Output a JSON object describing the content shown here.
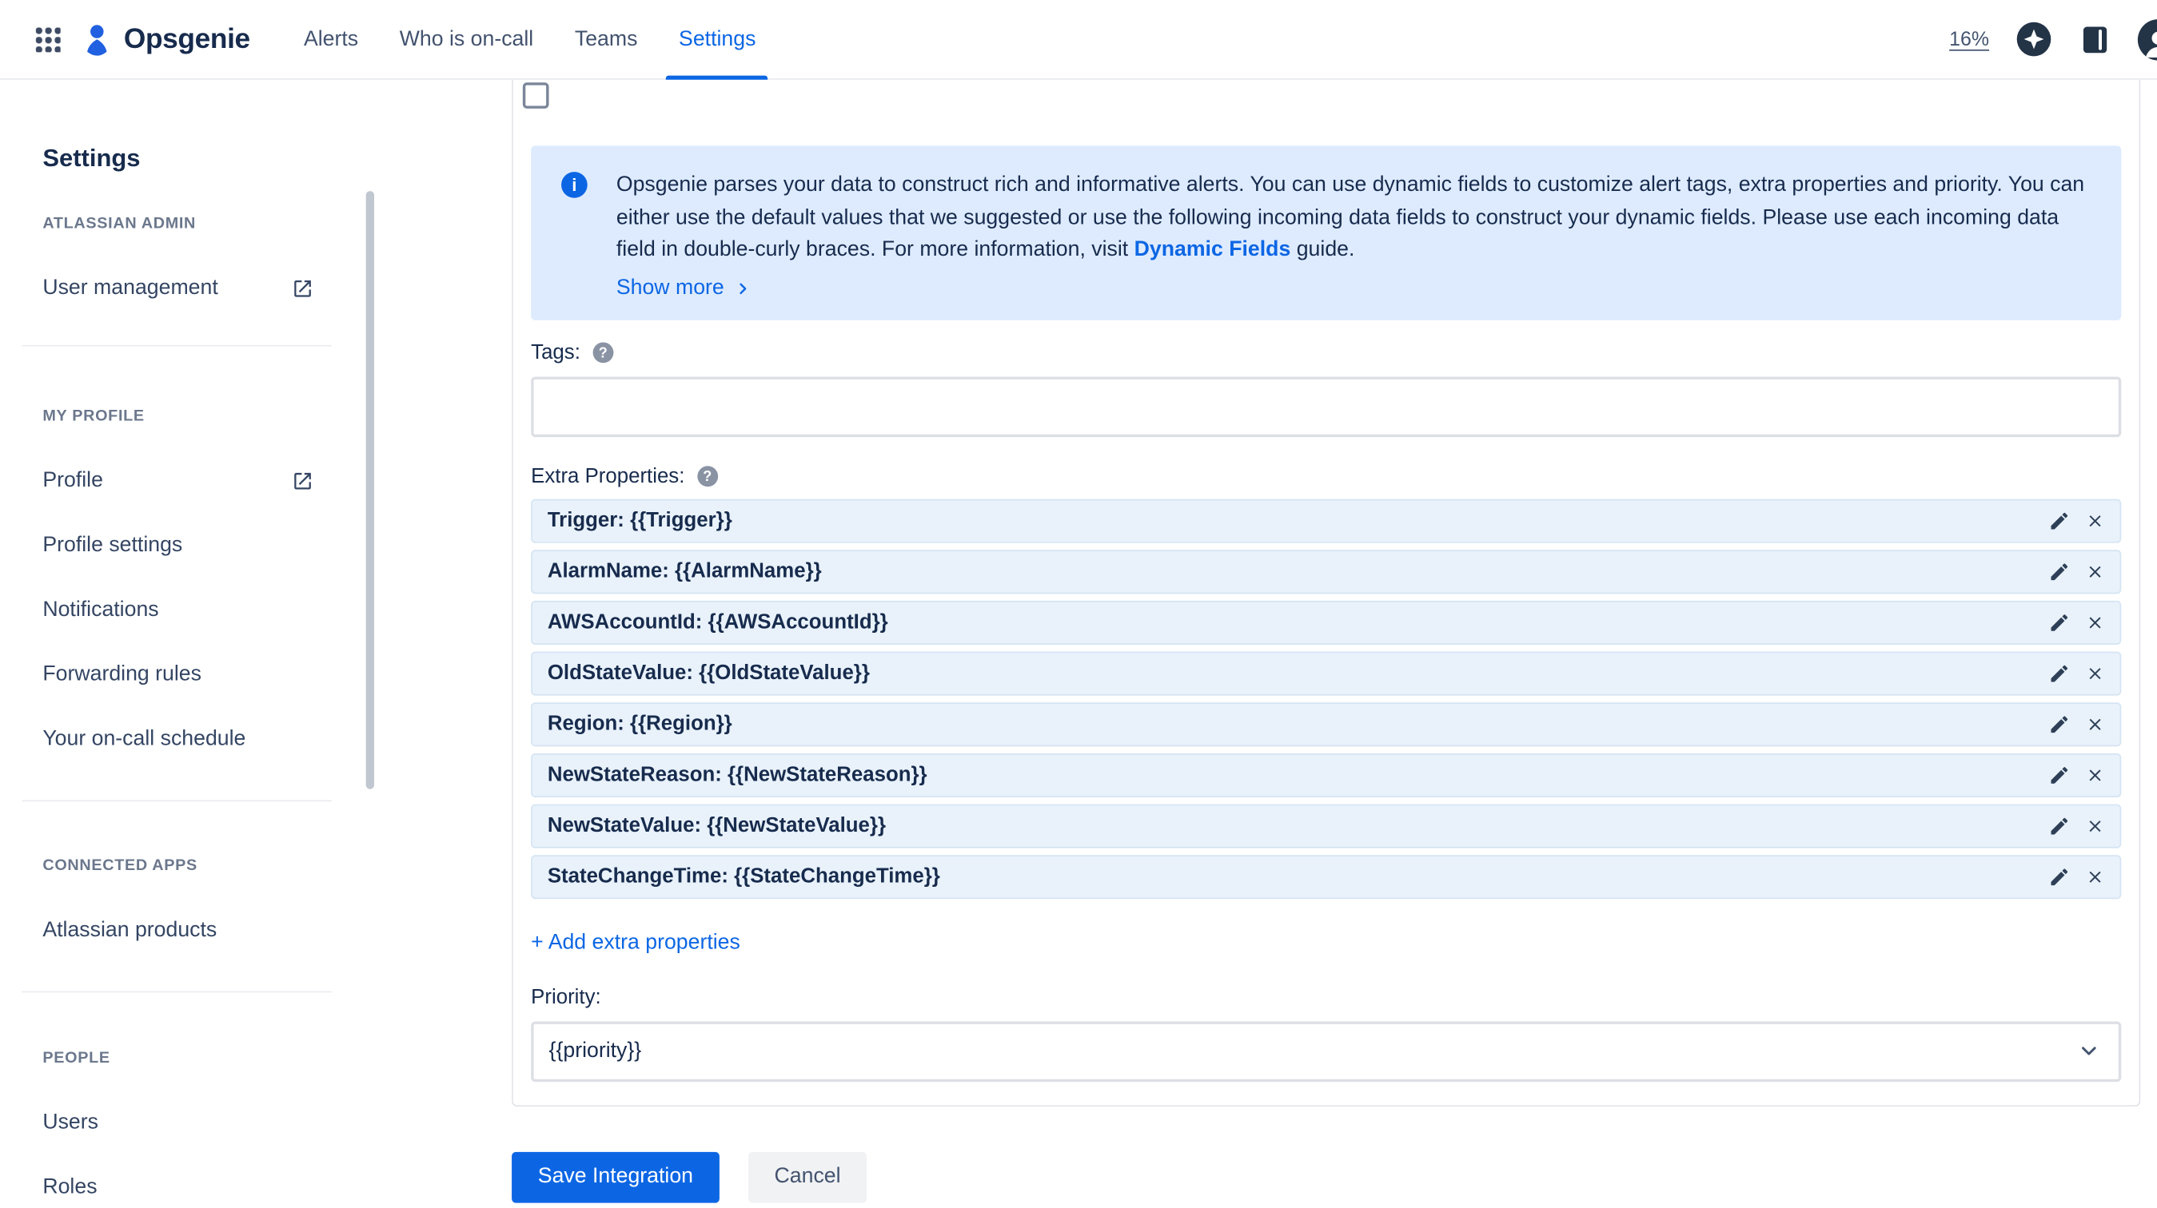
{
  "topnav": {
    "brand": "Opsgenie",
    "items": [
      "Alerts",
      "Who is on-call",
      "Teams",
      "Settings"
    ],
    "active_item": "Settings",
    "zoom_indicator": "16%"
  },
  "sidebar": {
    "title": "Settings",
    "sections": [
      {
        "label": "ATLASSIAN ADMIN",
        "items": [
          {
            "label": "User management",
            "external": true
          }
        ]
      },
      {
        "label": "MY PROFILE",
        "items": [
          {
            "label": "Profile",
            "external": true
          },
          {
            "label": "Profile settings",
            "external": false
          },
          {
            "label": "Notifications",
            "external": false
          },
          {
            "label": "Forwarding rules",
            "external": false
          },
          {
            "label": "Your on-call schedule",
            "external": false
          }
        ]
      },
      {
        "label": "CONNECTED APPS",
        "items": [
          {
            "label": "Atlassian products",
            "external": false
          }
        ]
      },
      {
        "label": "PEOPLE",
        "items": [
          {
            "label": "Users",
            "external": false
          },
          {
            "label": "Roles",
            "external": false
          }
        ]
      }
    ]
  },
  "main": {
    "info_banner": {
      "text_before_link": "Opsgenie parses your data to construct rich and informative alerts. You can use dynamic fields to customize alert tags, extra properties and priority. You can either use the default values that we suggested or use the following incoming data fields to construct your dynamic fields. Please use each incoming data field in double-curly braces. For more information, visit",
      "link_text": "Dynamic Fields",
      "text_after_link": "guide.",
      "show_more_label": "Show more"
    },
    "tags_field": {
      "label": "Tags:",
      "value": ""
    },
    "extra_properties": {
      "label": "Extra Properties:",
      "rows": [
        "Trigger: {{Trigger}}",
        "AlarmName: {{AlarmName}}",
        "AWSAccountId: {{AWSAccountId}}",
        "OldStateValue: {{OldStateValue}}",
        "Region: {{Region}}",
        "NewStateReason: {{NewStateReason}}",
        "NewStateValue: {{NewStateValue}}",
        "StateChangeTime: {{StateChangeTime}}"
      ],
      "add_link_label": "+ Add extra properties"
    },
    "priority_field": {
      "label": "Priority:",
      "value": "{{priority}}"
    },
    "actions": {
      "save_label": "Save Integration",
      "cancel_label": "Cancel"
    }
  },
  "colors": {
    "accent_blue": "#0C66E4",
    "banner_bg": "#DEEBFF",
    "prop_row_bg": "#E9F2FB",
    "text_primary": "#172B4D",
    "muted_label": "#6B778C"
  }
}
